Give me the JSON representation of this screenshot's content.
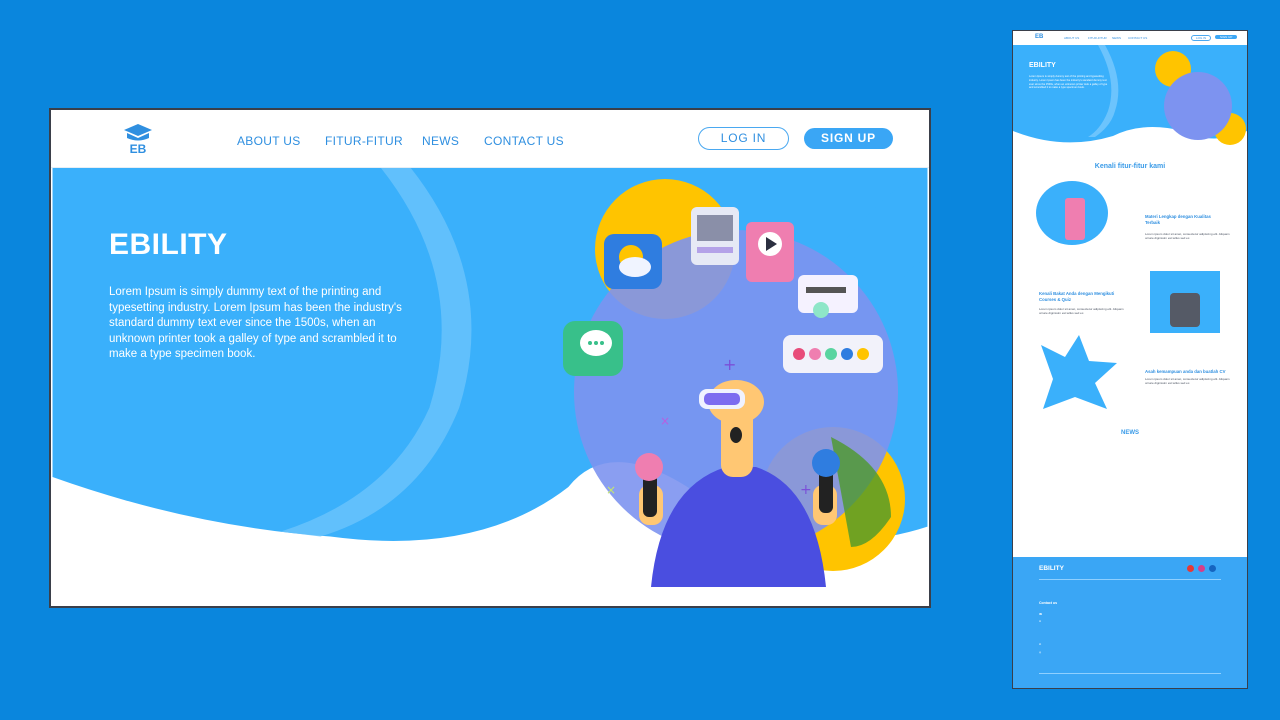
{
  "brand": {
    "name": "EBILITY",
    "logo_text": "EB"
  },
  "nav": {
    "links": [
      "ABOUT US",
      "FITUR-FITUR",
      "NEWS",
      "CONTACT US"
    ],
    "login": "LOG IN",
    "signup": "SIGN UP"
  },
  "hero": {
    "title": "EBILITY",
    "text": "Lorem Ipsum is simply dummy text of the printing and typesetting industry. Lorem Ipsum has been the industry's standard dummy text ever since the 1500s, when an unknown printer took a galley of type and scrambled it to make a type specimen book."
  },
  "preview": {
    "nav_links": [
      "ABOUT US",
      "FITUR-FITUR",
      "NEWS",
      "CONTACT US"
    ],
    "login": "LOG IN",
    "signup": "SIGN UP",
    "hero_title": "EBILITY",
    "features_title": "Kenali fitur-fitur kami",
    "features": [
      {
        "title": "Materi Lengkap dengan Kualitas Terbaik",
        "text": "Lorem ipsum dolor sit amet, consectetur adipiscing elit. Aliquam ornare dignissim est tellus sed ex."
      },
      {
        "title": "Kenali Bakat Anda dengan Mengikuti Courses & Quiz",
        "text": "Lorem ipsum dolor sit amet, consectetur adipiscing elit. Aliquam ornare dignissim est tellus sed ex."
      },
      {
        "title": "Asah kemampuan anda dan buatlah CV",
        "text": "Lorem ipsum dolor sit amet, consectetur adipiscing elit. Aliquam ornare dignissim est tellus sed ex."
      }
    ],
    "news_title": "NEWS",
    "footer_title": "EBILITY",
    "contact_title": "Contact us"
  },
  "colors": {
    "page_bg": "#0a86dd",
    "hero_blue": "#3ab0fb",
    "accent": "#2f8fe0",
    "yellow": "#ffc400"
  }
}
